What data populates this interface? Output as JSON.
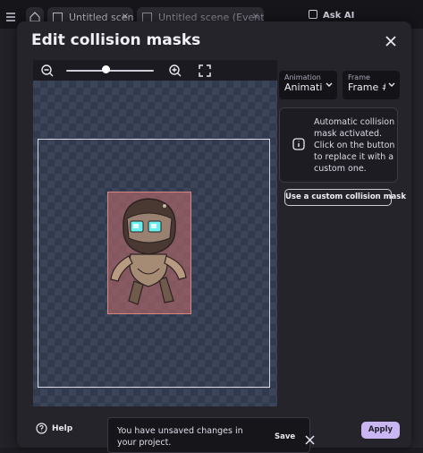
{
  "app": {
    "tabs": [
      {
        "label": "Untitled scene",
        "close": "×"
      },
      {
        "label": "Untitled scene (Events)",
        "close": "×"
      }
    ],
    "ask_ai": "Ask AI"
  },
  "dialog": {
    "title": "Edit collision masks",
    "animation_select": {
      "label": "Animation",
      "value": "Animati"
    },
    "frame_select": {
      "label": "Frame",
      "value": "Frame #"
    },
    "info_text": "Automatic collision mask activated. Click on the button to replace it with a custom one.",
    "custom_mask_button": "Use a custom collision mask",
    "help_label": "Help",
    "unsaved": {
      "text": "You have unsaved changes in your project.",
      "save_label": "Save"
    },
    "apply_label": "Apply"
  },
  "colors": {
    "accent": "#c9b6f2",
    "mask_fill": "#c96f6d",
    "dialog_bg": "#25242b"
  },
  "icons": [
    "zoom-out-icon",
    "zoom-in-icon",
    "fit-screen-icon",
    "close-icon",
    "chevron-down-icon",
    "info-icon",
    "help-icon"
  ],
  "zoom": {
    "level_fraction": 0.45
  }
}
